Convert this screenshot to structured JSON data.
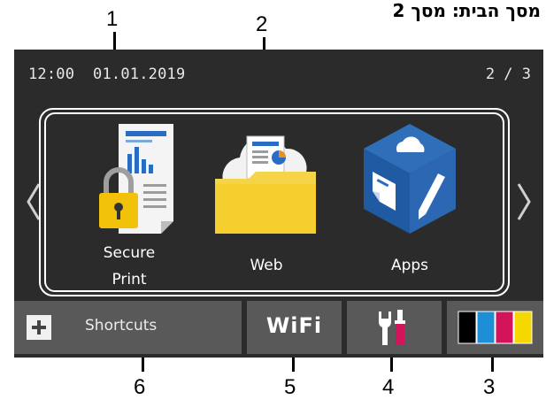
{
  "caption": "מסך הבית: מסך 2",
  "callouts": [
    "1",
    "2",
    "3",
    "4",
    "5",
    "6"
  ],
  "status": {
    "datetime": "12:00  01.01.2019",
    "page": "2 / 3"
  },
  "tiles": [
    {
      "label_line1": "Secure",
      "label_line2": "Print",
      "icon": "secure-print-icon"
    },
    {
      "label_line1": "Web",
      "icon": "web-cloud-folder-icon"
    },
    {
      "label_line1": "Apps",
      "icon": "apps-cube-icon"
    }
  ],
  "bottom": {
    "shortcuts_label": "Shortcuts",
    "wifi_label": "WiFi"
  },
  "colors": {
    "background": "#2b2b2b",
    "button": "#595959",
    "cyan": "#1e8fd6",
    "magenta": "#d4145a",
    "yellow": "#f5d800",
    "black": "#000000"
  }
}
